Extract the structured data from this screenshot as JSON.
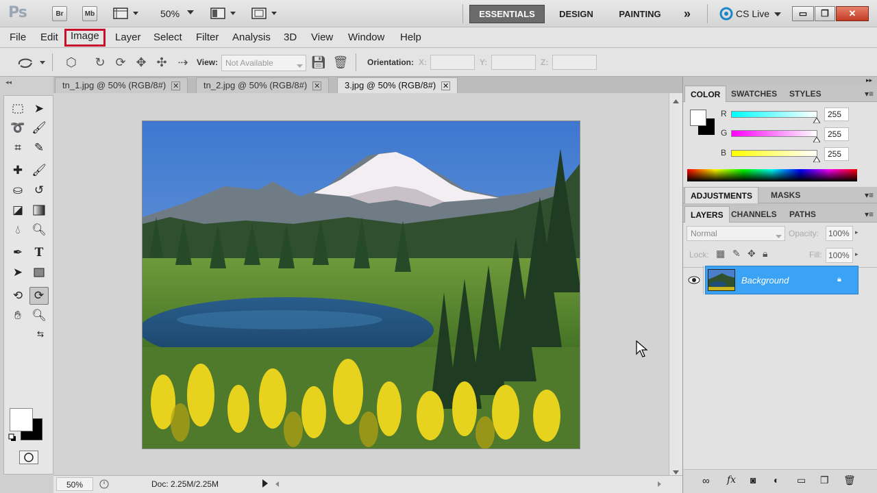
{
  "app": {
    "logo": "Ps",
    "bridge_label": "Br",
    "minibridge_label": "Mb",
    "zoom": "50%",
    "workspaces": [
      "ESSENTIALS",
      "DESIGN",
      "PAINTING"
    ],
    "more_label": "»",
    "cslive_label": "CS Live"
  },
  "menu": [
    "File",
    "Edit",
    "Image",
    "Layer",
    "Select",
    "Filter",
    "Analysis",
    "3D",
    "View",
    "Window",
    "Help"
  ],
  "options": {
    "view_label": "View:",
    "view_value": "Not Available",
    "orientation_label": "Orientation:",
    "x_label": "X:",
    "y_label": "Y:",
    "z_label": "Z:"
  },
  "tabs": [
    {
      "label": "tn_1.jpg @ 50% (RGB/8#)"
    },
    {
      "label": "tn_2.jpg @ 50% (RGB/8#)"
    },
    {
      "label": "3.jpg @ 50% (RGB/8#)"
    }
  ],
  "status": {
    "zoom": "50%",
    "doc": "Doc: 2.25M/2.25M"
  },
  "color_panel": {
    "tabs": [
      "COLOR",
      "SWATCHES",
      "STYLES"
    ],
    "channels": [
      {
        "label": "R",
        "value": "255"
      },
      {
        "label": "G",
        "value": "255"
      },
      {
        "label": "B",
        "value": "255"
      }
    ]
  },
  "adjust_panel": {
    "tabs": [
      "ADJUSTMENTS",
      "MASKS"
    ]
  },
  "layers_panel": {
    "tabs": [
      "LAYERS",
      "CHANNELS",
      "PATHS"
    ],
    "blend_mode": "Normal",
    "opacity_label": "Opacity:",
    "opacity": "100%",
    "lock_label": "Lock:",
    "fill_label": "Fill:",
    "fill": "100%",
    "layers": [
      {
        "name": "Background"
      }
    ]
  }
}
